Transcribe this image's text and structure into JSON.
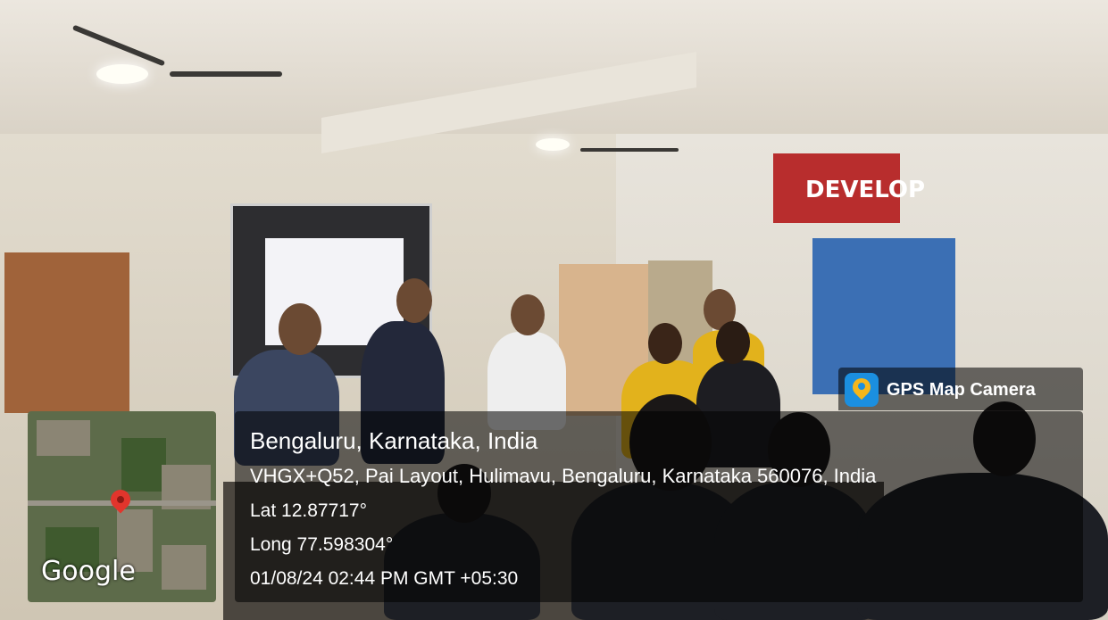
{
  "poster": {
    "text": "DEVELOP"
  },
  "stamp": {
    "app_name": "GPS Map Camera",
    "city_line": "Bengaluru, Karnataka, India",
    "address": "VHGX+Q52, Pai Layout, Hulimavu, Bengaluru, Karnataka 560076, India",
    "latitude": "Lat 12.87717°",
    "longitude": "Long 77.598304°",
    "datetime": "01/08/24 02:44 PM GMT +05:30",
    "map_brand": "Google"
  },
  "icons": {
    "app": "map-pin-camera-icon",
    "marker": "location-pin-icon"
  }
}
